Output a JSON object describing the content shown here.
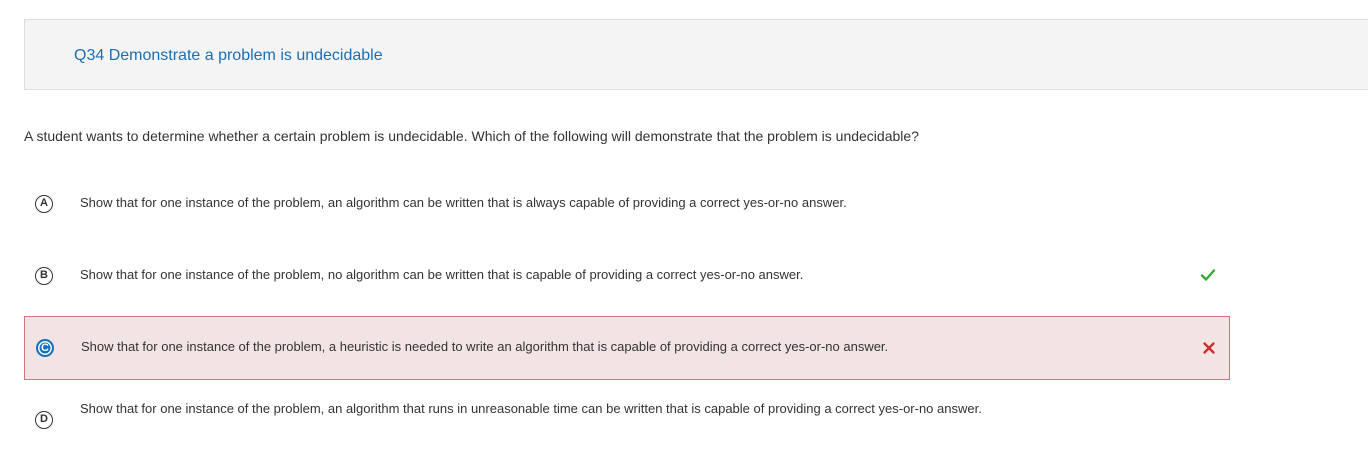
{
  "question": {
    "title": "Q34 Demonstrate a problem is undecidable",
    "prompt": "A student wants to determine whether a certain problem is undecidable. Which of the following will demonstrate that the problem is undecidable?"
  },
  "options": [
    {
      "letter": "A",
      "text": "Show that for one instance of the problem, an algorithm can be written that is always capable of providing a correct yes-or-no answer.",
      "state": "none"
    },
    {
      "letter": "B",
      "text": "Show that for one instance of the problem, no algorithm can be written that is capable of providing a correct yes-or-no answer.",
      "state": "correct",
      "mark_icon": "checkmark-icon"
    },
    {
      "letter": "C",
      "text": "Show that for one instance of the problem, a heuristic is needed to write an algorithm that is capable of providing a correct yes-or-no answer.",
      "state": "selected-incorrect",
      "mark_icon": "x-icon"
    },
    {
      "letter": "D",
      "text": "Show that for one instance of the problem, an algorithm that runs in unreasonable time can be written that is capable of providing a correct yes-or-no answer.",
      "state": "none"
    }
  ],
  "colors": {
    "accent": "#1a6fb6",
    "correct": "#3aa935",
    "incorrect": "#c9302c",
    "incorrect_bg": "#f2e4e5",
    "incorrect_border": "#d9707a"
  }
}
